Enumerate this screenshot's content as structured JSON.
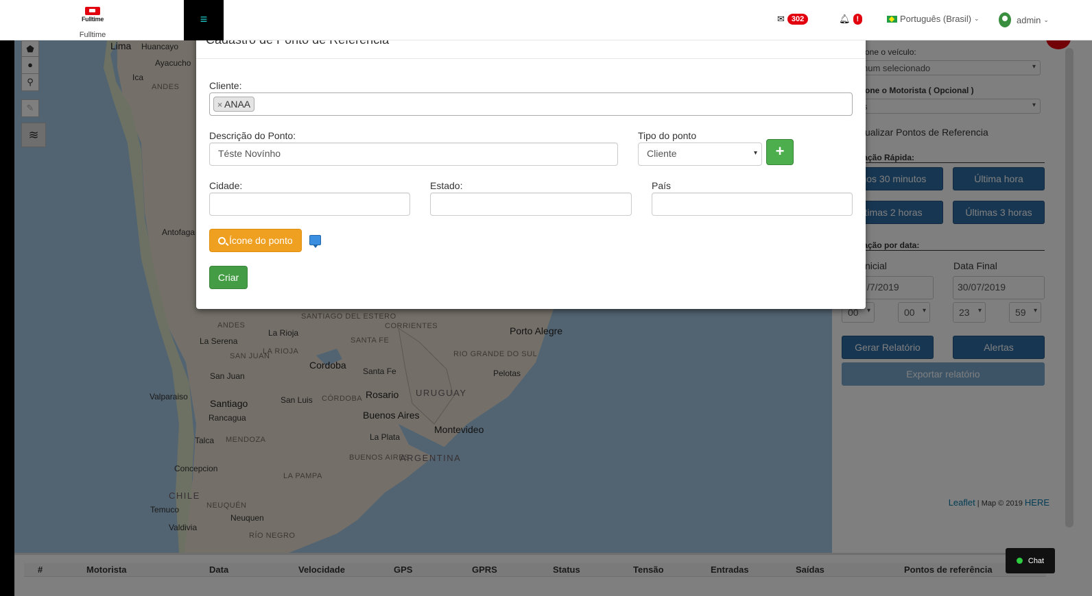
{
  "brand": {
    "logo_text": "Fulltime",
    "name": "Fulltime"
  },
  "navbar": {
    "messages_count": "302",
    "notifications_badge": "!",
    "language": "Português (Brasil)",
    "user": "admin"
  },
  "map": {
    "labels": [
      {
        "text": "Lima",
        "cls": "big"
      },
      {
        "text": "Huancayo",
        "cls": ""
      },
      {
        "text": "Ayacucho",
        "cls": ""
      },
      {
        "text": "Ica",
        "cls": ""
      },
      {
        "text": "Andes",
        "cls": "region"
      },
      {
        "text": "Antofaga",
        "cls": ""
      },
      {
        "text": "Andes",
        "cls": "region"
      },
      {
        "text": "SANTIAGO DEL ESTERO",
        "cls": "region"
      },
      {
        "text": "CORRIENTES",
        "cls": "region"
      },
      {
        "text": "Porto Alegre",
        "cls": "big"
      },
      {
        "text": "La Serena",
        "cls": ""
      },
      {
        "text": "La Rioja",
        "cls": ""
      },
      {
        "text": "LA RIOJA",
        "cls": "region"
      },
      {
        "text": "SANTA FE",
        "cls": "region"
      },
      {
        "text": "RIO GRANDE DO SUL",
        "cls": "region"
      },
      {
        "text": "SAN JUAN",
        "cls": "region"
      },
      {
        "text": "Cordoba",
        "cls": "big"
      },
      {
        "text": "Santa Fe",
        "cls": ""
      },
      {
        "text": "San Juan",
        "cls": ""
      },
      {
        "text": "Pelotas",
        "cls": ""
      },
      {
        "text": "Valparaiso",
        "cls": ""
      },
      {
        "text": "Santiago",
        "cls": "big"
      },
      {
        "text": "San Luis",
        "cls": ""
      },
      {
        "text": "CÓRDOBA",
        "cls": "region"
      },
      {
        "text": "Rosario",
        "cls": "big"
      },
      {
        "text": "URUGUAY",
        "cls": "country"
      },
      {
        "text": "Rancagua",
        "cls": ""
      },
      {
        "text": "Buenos Aires",
        "cls": "big"
      },
      {
        "text": "Montevideo",
        "cls": "big"
      },
      {
        "text": "MENDOZA",
        "cls": "region"
      },
      {
        "text": "La Plata",
        "cls": ""
      },
      {
        "text": "Talca",
        "cls": ""
      },
      {
        "text": "ARGENTINA",
        "cls": "country"
      },
      {
        "text": "BUENOS AIRES",
        "cls": "region"
      },
      {
        "text": "Concepcion",
        "cls": ""
      },
      {
        "text": "LA PAMPA",
        "cls": "region"
      },
      {
        "text": "CHILE",
        "cls": "country"
      },
      {
        "text": "Temuco",
        "cls": ""
      },
      {
        "text": "NEUQUÉN",
        "cls": "region"
      },
      {
        "text": "Neuquen",
        "cls": ""
      },
      {
        "text": "Valdivia",
        "cls": ""
      },
      {
        "text": "RÍO NEGRO",
        "cls": "region"
      }
    ],
    "attribution_leaflet": "Leaflet",
    "attribution_map": " | Map © 2019 ",
    "attribution_here": "HERE"
  },
  "panel": {
    "vehicle_label": "one o veículo:",
    "vehicle_value": "num selecionado",
    "driver_label": "one o Motorista ( Opcional )",
    "driver_value": "s",
    "show_points": "ualizar Pontos de Referencia",
    "quick_heading": "ização Rápida:",
    "btn_30min": "mos 30 minutos",
    "btn_1h": "Última hora",
    "btn_2h": "ltimas 2 horas",
    "btn_3h": "Últimas 3 horas",
    "date_heading": "ização por data:",
    "start_label": "nicial",
    "end_label": "Data Final",
    "start_date": "/7/2019",
    "end_date": "30/07/2019",
    "h1": "00",
    "m1": "00",
    "h2": "23",
    "m2": "59",
    "btn_report": "Gerar Relatório",
    "btn_alerts": "Alertas",
    "btn_export": "Exportar relatório"
  },
  "table": {
    "columns": [
      "#",
      "Motorista",
      "Data",
      "Velocidade",
      "GPS",
      "GPRS",
      "Status",
      "Tensão",
      "Entradas",
      "Saídas",
      "Pontos de referência"
    ]
  },
  "modal": {
    "title": "Cadastro de Ponto de Referencia",
    "client_label": "Cliente:",
    "client_tag": "ANAA",
    "tag_remove": "×",
    "desc_label": "Descrição do Ponto:",
    "desc_value": "Téste Novínho",
    "type_label": "Tipo do ponto",
    "type_value": "Cliente",
    "city_label": "Cidade:",
    "state_label": "Estado:",
    "country_label": "País",
    "icon_button": "Ícone do ponto",
    "create_button": "Criar"
  },
  "chat": {
    "label": "Chat"
  }
}
